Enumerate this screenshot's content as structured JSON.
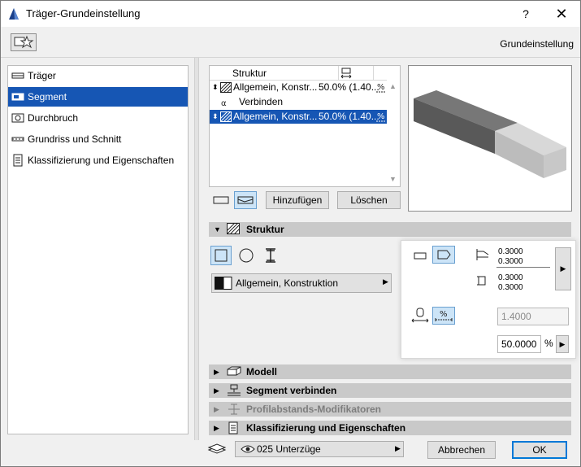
{
  "window": {
    "title": "Träger-Grundeinstellung",
    "help_label": "?",
    "close_label": "✕"
  },
  "header": {
    "label": "Grundeinstellung"
  },
  "nav": {
    "items": [
      {
        "label": "Träger",
        "icon": "beam-icon"
      },
      {
        "label": "Segment",
        "icon": "segment-icon"
      },
      {
        "label": "Durchbruch",
        "icon": "hole-icon"
      },
      {
        "label": "Grundriss und Schnitt",
        "icon": "floorplan-icon"
      },
      {
        "label": "Klassifizierung und Eigenschaften",
        "icon": "classification-icon"
      }
    ],
    "selected": 1
  },
  "structure_list": {
    "header": "Struktur",
    "rows": [
      {
        "name": "Allgemein, Konstr...",
        "value": "50.0% (1.40..."
      },
      {
        "name": "Verbinden",
        "value": ""
      },
      {
        "name": "Allgemein, Konstr...",
        "value": "50.0% (1.40..."
      }
    ],
    "selected": 2
  },
  "list_buttons": {
    "add": "Hinzufügen",
    "delete": "Löschen"
  },
  "sections": {
    "struktur": "Struktur",
    "modell": "Modell",
    "segment_verbinden": "Segment verbinden",
    "profil_mod": "Profilabstands-Modifikatoren",
    "klassifizierung": "Klassifizierung und Eigenschaften"
  },
  "profile": {
    "label": "Allgemein, Konstruktion"
  },
  "dims": {
    "w1": "0.3000",
    "h1": "0.3000",
    "w2": "0.3000",
    "h2": "0.3000"
  },
  "length": {
    "value": "1.4000"
  },
  "percent": {
    "value": "50.0000",
    "unit": "%"
  },
  "footer": {
    "layer": "025 Unterzüge",
    "cancel": "Abbrechen",
    "ok": "OK"
  },
  "colors": {
    "selection": "#1656b4",
    "accent": "#0078d7",
    "section_bg": "#c9c9c9"
  }
}
